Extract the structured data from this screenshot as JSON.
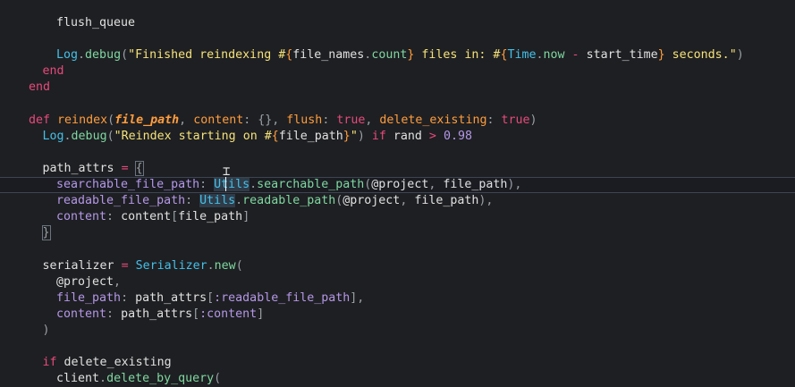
{
  "editor": {
    "language": "ruby",
    "lines": [
      {
        "indent": 2,
        "tokens": [
          {
            "t": "flush_queue",
            "c": "var"
          }
        ]
      },
      {
        "indent": 0,
        "tokens": []
      },
      {
        "indent": 2,
        "tokens": [
          {
            "t": "Log",
            "c": "cn"
          },
          {
            "t": ".",
            "c": "pun"
          },
          {
            "t": "debug",
            "c": "meth"
          },
          {
            "t": "(",
            "c": "pun"
          },
          {
            "t": "\"Finished reindexing #",
            "c": "str"
          },
          {
            "t": "{",
            "c": "fn"
          },
          {
            "t": "file_names",
            "c": "var"
          },
          {
            "t": ".",
            "c": "pun"
          },
          {
            "t": "count",
            "c": "meth"
          },
          {
            "t": "}",
            "c": "fn"
          },
          {
            "t": " files in: #",
            "c": "str"
          },
          {
            "t": "{",
            "c": "fn"
          },
          {
            "t": "Time",
            "c": "cn"
          },
          {
            "t": ".",
            "c": "pun"
          },
          {
            "t": "now",
            "c": "meth"
          },
          {
            "t": " - ",
            "c": "op"
          },
          {
            "t": "start_time",
            "c": "var"
          },
          {
            "t": "}",
            "c": "fn"
          },
          {
            "t": " seconds.\"",
            "c": "str"
          },
          {
            "t": ")",
            "c": "pun"
          }
        ]
      },
      {
        "indent": 1,
        "tokens": [
          {
            "t": "end",
            "c": "kw"
          }
        ]
      },
      {
        "indent": 0,
        "tokens": [
          {
            "t": "end",
            "c": "kw"
          }
        ]
      },
      {
        "indent": 0,
        "tokens": []
      },
      {
        "indent": 0,
        "tokens": [
          {
            "t": "def",
            "c": "kw"
          },
          {
            "t": " ",
            "c": "var"
          },
          {
            "t": "reindex",
            "c": "fn"
          },
          {
            "t": "(",
            "c": "pun"
          },
          {
            "t": "file_path",
            "c": "fni"
          },
          {
            "t": ", ",
            "c": "pun"
          },
          {
            "t": "content",
            "c": "fn"
          },
          {
            "t": ": ",
            "c": "pun"
          },
          {
            "t": "{}",
            "c": "pun"
          },
          {
            "t": ", ",
            "c": "pun"
          },
          {
            "t": "flush",
            "c": "fn"
          },
          {
            "t": ": ",
            "c": "pun"
          },
          {
            "t": "true",
            "c": "kw"
          },
          {
            "t": ", ",
            "c": "pun"
          },
          {
            "t": "delete_existing",
            "c": "fn"
          },
          {
            "t": ": ",
            "c": "pun"
          },
          {
            "t": "true",
            "c": "kw"
          },
          {
            "t": ")",
            "c": "pun"
          }
        ]
      },
      {
        "indent": 1,
        "tokens": [
          {
            "t": "Log",
            "c": "cn"
          },
          {
            "t": ".",
            "c": "pun"
          },
          {
            "t": "debug",
            "c": "meth"
          },
          {
            "t": "(",
            "c": "pun"
          },
          {
            "t": "\"Reindex starting on #",
            "c": "str"
          },
          {
            "t": "{",
            "c": "fn"
          },
          {
            "t": "file_path",
            "c": "var"
          },
          {
            "t": "}",
            "c": "fn"
          },
          {
            "t": "\"",
            "c": "str"
          },
          {
            "t": ") ",
            "c": "pun"
          },
          {
            "t": "if",
            "c": "kw"
          },
          {
            "t": " ",
            "c": "var"
          },
          {
            "t": "rand",
            "c": "var"
          },
          {
            "t": " > ",
            "c": "op"
          },
          {
            "t": "0.98",
            "c": "num"
          }
        ]
      },
      {
        "indent": 0,
        "tokens": []
      },
      {
        "indent": 1,
        "tokens": [
          {
            "t": "path_attrs",
            "c": "var"
          },
          {
            "t": " = ",
            "c": "op"
          },
          {
            "t": "{",
            "c": "pun",
            "bh": true
          }
        ]
      },
      {
        "indent": 2,
        "current": true,
        "tokens": [
          {
            "t": "searchable_file_path",
            "c": "key"
          },
          {
            "t": ": ",
            "c": "pun"
          },
          {
            "t": "Utils",
            "c": "cn",
            "hl": true
          },
          {
            "t": ".",
            "c": "pun"
          },
          {
            "t": "searchable_path",
            "c": "meth"
          },
          {
            "t": "(",
            "c": "pun"
          },
          {
            "t": "@project",
            "c": "var"
          },
          {
            "t": ", ",
            "c": "pun"
          },
          {
            "t": "file_path",
            "c": "var"
          },
          {
            "t": "),",
            "c": "pun"
          }
        ]
      },
      {
        "indent": 2,
        "tokens": [
          {
            "t": "readable_file_path",
            "c": "key"
          },
          {
            "t": ": ",
            "c": "pun"
          },
          {
            "t": "Utils",
            "c": "cn",
            "hl": true
          },
          {
            "t": ".",
            "c": "pun"
          },
          {
            "t": "readable_path",
            "c": "meth"
          },
          {
            "t": "(",
            "c": "pun"
          },
          {
            "t": "@project",
            "c": "var"
          },
          {
            "t": ", ",
            "c": "pun"
          },
          {
            "t": "file_path",
            "c": "var"
          },
          {
            "t": "),",
            "c": "pun"
          }
        ]
      },
      {
        "indent": 2,
        "tokens": [
          {
            "t": "content",
            "c": "key"
          },
          {
            "t": ": ",
            "c": "pun"
          },
          {
            "t": "content",
            "c": "var"
          },
          {
            "t": "[",
            "c": "pun"
          },
          {
            "t": "file_path",
            "c": "var"
          },
          {
            "t": "]",
            "c": "pun"
          }
        ]
      },
      {
        "indent": 1,
        "tokens": [
          {
            "t": "}",
            "c": "pun",
            "bh": true
          }
        ]
      },
      {
        "indent": 0,
        "tokens": []
      },
      {
        "indent": 1,
        "tokens": [
          {
            "t": "serializer",
            "c": "var"
          },
          {
            "t": " = ",
            "c": "op"
          },
          {
            "t": "Serializer",
            "c": "cn"
          },
          {
            "t": ".",
            "c": "pun"
          },
          {
            "t": "new",
            "c": "meth"
          },
          {
            "t": "(",
            "c": "pun"
          }
        ]
      },
      {
        "indent": 2,
        "tokens": [
          {
            "t": "@project",
            "c": "var"
          },
          {
            "t": ",",
            "c": "pun"
          }
        ]
      },
      {
        "indent": 2,
        "tokens": [
          {
            "t": "file_path",
            "c": "key"
          },
          {
            "t": ": ",
            "c": "pun"
          },
          {
            "t": "path_attrs",
            "c": "var"
          },
          {
            "t": "[",
            "c": "pun"
          },
          {
            "t": ":readable_file_path",
            "c": "sym"
          },
          {
            "t": "],",
            "c": "pun"
          }
        ]
      },
      {
        "indent": 2,
        "tokens": [
          {
            "t": "content",
            "c": "key"
          },
          {
            "t": ": ",
            "c": "pun"
          },
          {
            "t": "path_attrs",
            "c": "var"
          },
          {
            "t": "[",
            "c": "pun"
          },
          {
            "t": ":content",
            "c": "sym"
          },
          {
            "t": "]",
            "c": "pun"
          }
        ]
      },
      {
        "indent": 1,
        "tokens": [
          {
            "t": ")",
            "c": "pun"
          }
        ]
      },
      {
        "indent": 0,
        "tokens": []
      },
      {
        "indent": 1,
        "tokens": [
          {
            "t": "if",
            "c": "kw"
          },
          {
            "t": " ",
            "c": "var"
          },
          {
            "t": "delete_existing",
            "c": "var"
          }
        ]
      },
      {
        "indent": 2,
        "tokens": [
          {
            "t": "client",
            "c": "var"
          },
          {
            "t": ".",
            "c": "pun"
          },
          {
            "t": "delete_by_query",
            "c": "meth"
          },
          {
            "t": "(",
            "c": "pun"
          }
        ]
      }
    ]
  },
  "colors": {
    "background": "#1e1f22",
    "current_line_border": "#3b4552",
    "keyword": "#e64a7b",
    "function": "#ff9d3d",
    "constant": "#44c0e8",
    "string": "#f5e27a",
    "symbol": "#b497e7",
    "method": "#7fd7a1"
  },
  "mouse_pointer": "text-cursor-icon"
}
